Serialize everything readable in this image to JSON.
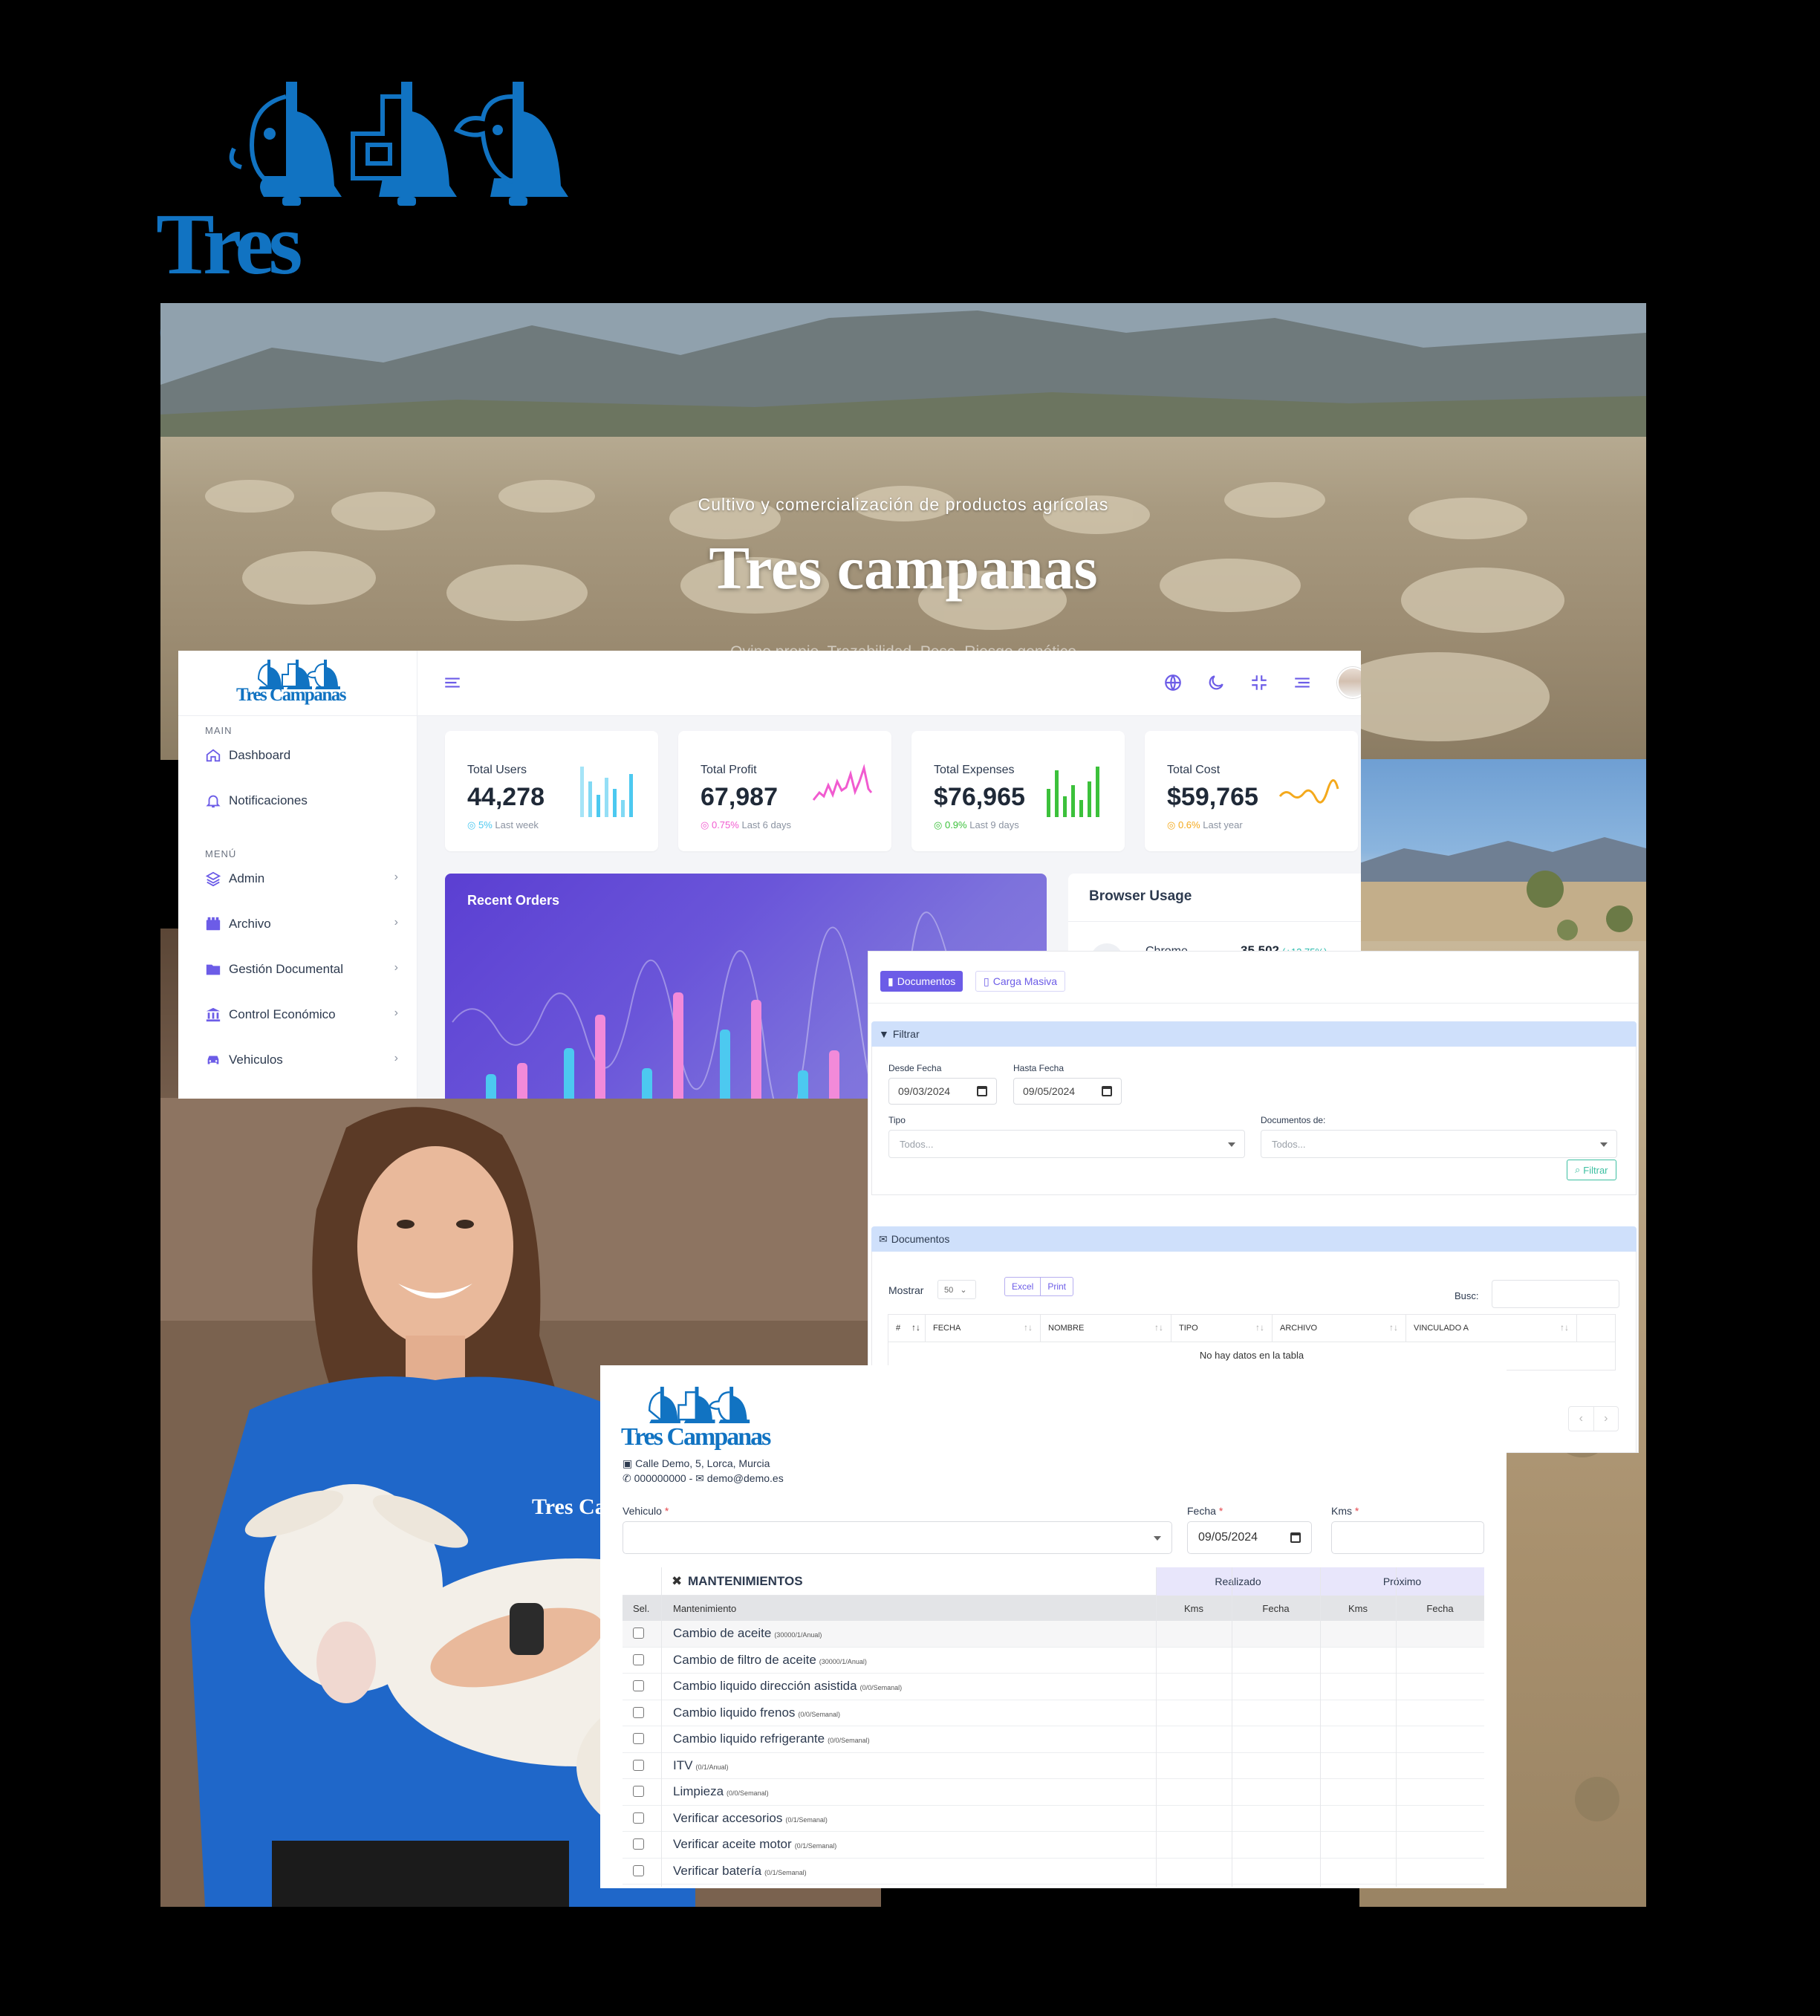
{
  "brand": {
    "name": "Tres Campanas"
  },
  "hero": {
    "subtitle": "Cultivo y comercialización de productos agrícolas",
    "title": "Tres campanas",
    "tagline": "Ovino propio. Trazabilidad. Peso. Riesgo genético"
  },
  "dashboard": {
    "logo_text": "Tres Campanas",
    "sections": {
      "main": "MAIN",
      "menu": "MENÚ"
    },
    "nav": {
      "dashboard": "Dashboard",
      "notificaciones": "Notificaciones",
      "admin": "Admin",
      "archivo": "Archivo",
      "gestion": "Gestión Documental",
      "control": "Control Económico",
      "vehiculos": "Vehiculos"
    },
    "chevron": "›",
    "stats": [
      {
        "label": "Total Users",
        "value": "44,278",
        "change": "5%",
        "period": "Last week",
        "color": "#4cc9f0"
      },
      {
        "label": "Total Profit",
        "value": "67,987",
        "change": "0.75%",
        "period": "Last 6 days",
        "color": "#f15bd0"
      },
      {
        "label": "Total Expenses",
        "value": "$76,965",
        "change": "0.9%",
        "period": "Last 9 days",
        "color": "#3cc13b"
      },
      {
        "label": "Total Cost",
        "value": "$59,765",
        "change": "0.6%",
        "period": "Last year",
        "color": "#f4a91c"
      }
    ],
    "recent_orders": "Recent Orders",
    "browser_usage": {
      "title": "Browser Usage",
      "row": {
        "name": "Chrome",
        "value": "35,502",
        "pct": "(+12.75%)"
      }
    }
  },
  "docs": {
    "tabs": {
      "documentos": "Documentos",
      "carga": "Carga Masiva"
    },
    "filter": {
      "title": "Filtrar",
      "desde_label": "Desde Fecha",
      "desde_value": "09/03/2024",
      "hasta_label": "Hasta Fecha",
      "hasta_value": "09/05/2024",
      "tipo_label": "Tipo",
      "tipo_value": "Todos...",
      "docs_de_label": "Documentos de:",
      "docs_de_value": "Todos...",
      "button": "Filtrar"
    },
    "list": {
      "title": "Documentos",
      "mostrar": "Mostrar",
      "mostrar_value": "50",
      "excel": "Excel",
      "print": "Print",
      "busc": "Busc:",
      "columns": [
        "#",
        "FECHA",
        "NOMBRE",
        "TIPO",
        "ARCHIVO",
        "VINCULADO A"
      ],
      "empty": "No hay datos en la tabla",
      "sort": "↑↓"
    }
  },
  "maint": {
    "logo_text": "Tres Campanas",
    "address": "Calle Demo, 5, Lorca, Murcia",
    "phone": "000000000",
    "sep": "-",
    "email": "demo@demo.es",
    "vehiculo_label": "Vehiculo",
    "fecha_label": "Fecha",
    "fecha_value": "09/05/2024",
    "kms_label": "Kms",
    "required_mark": "*",
    "table": {
      "title": "MANTENIMIENTOS",
      "realizado": "Realizado",
      "proximo": "Próximo",
      "sel": "Sel.",
      "mantenimiento": "Mantenimiento",
      "kms": "Kms",
      "fecha": "Fecha",
      "rows": [
        {
          "name": "Cambio de aceite",
          "note": "(30000/1/Anual)"
        },
        {
          "name": "Cambio de filtro de aceite",
          "note": "(30000/1/Anual)"
        },
        {
          "name": "Cambio liquido dirección asistida",
          "note": "(0/0/Semanal)"
        },
        {
          "name": "Cambio liquido frenos",
          "note": "(0/0/Semanal)"
        },
        {
          "name": "Cambio liquido refrigerante",
          "note": "(0/0/Semanal)"
        },
        {
          "name": "ITV",
          "note": "(0/1/Anual)"
        },
        {
          "name": "Limpieza",
          "note": "(0/0/Semanal)"
        },
        {
          "name": "Verificar accesorios",
          "note": "(0/1/Semanal)"
        },
        {
          "name": "Verificar aceite motor",
          "note": "(0/1/Semanal)"
        },
        {
          "name": "Verificar batería",
          "note": "(0/1/Semanal)"
        }
      ]
    }
  }
}
